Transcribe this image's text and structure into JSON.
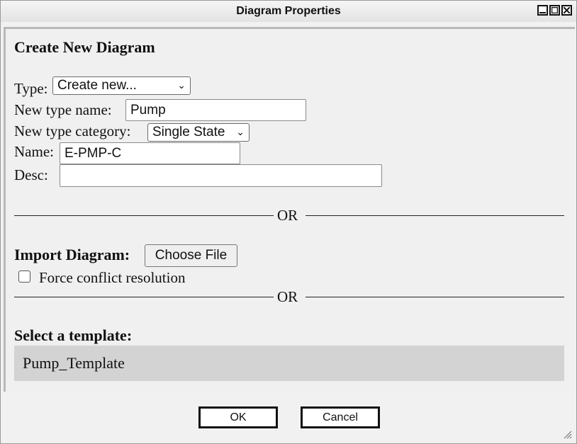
{
  "window": {
    "title": "Diagram Properties"
  },
  "create": {
    "heading": "Create New Diagram",
    "type_label": "Type:",
    "type_value": "Create new...",
    "new_type_name_label": "New type name:",
    "new_type_name_value": "Pump",
    "new_type_category_label": "New type category:",
    "new_type_category_value": "Single State",
    "name_label": "Name:",
    "name_value": "E-PMP-C",
    "desc_label": "Desc:",
    "desc_value": ""
  },
  "separator": {
    "or_text": "OR"
  },
  "import": {
    "label": "Import Diagram:",
    "choose_file_label": "Choose File",
    "force_conflict_label": "Force conflict resolution",
    "force_conflict_checked": false
  },
  "template": {
    "label": "Select a template:",
    "items": [
      "Pump_Template"
    ]
  },
  "buttons": {
    "ok": "OK",
    "cancel": "Cancel"
  },
  "icons": {
    "minimize": "minimize-icon",
    "maximize": "maximize-icon",
    "close": "close-icon",
    "dropdown": "chevron-down-icon",
    "resize": "resize-grip-icon"
  }
}
